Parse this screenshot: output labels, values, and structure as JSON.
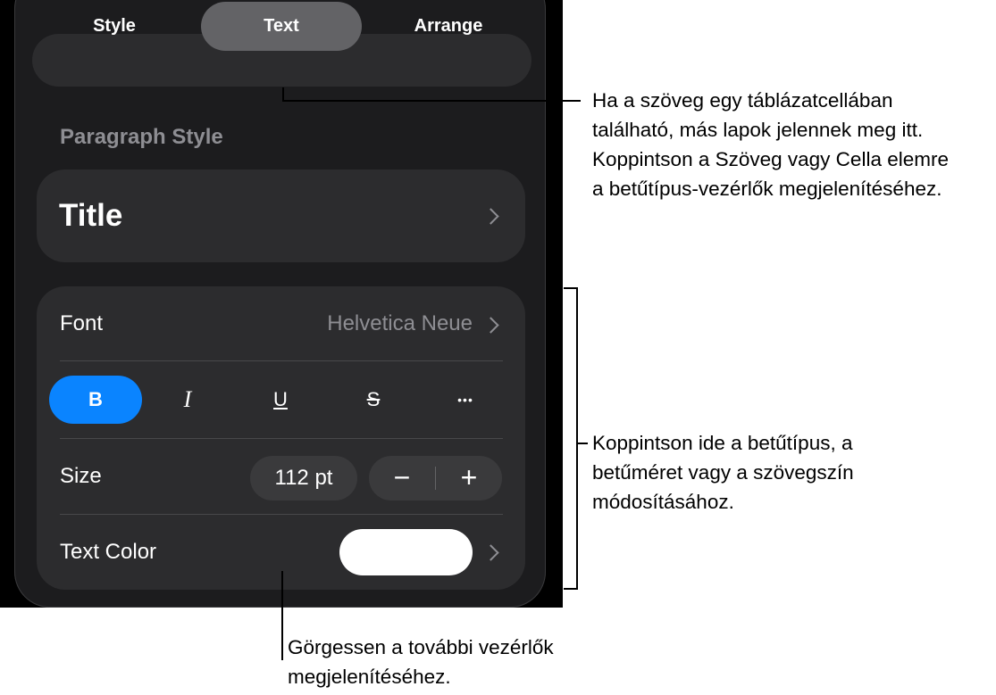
{
  "tabs": [
    {
      "label": "Style",
      "active": false
    },
    {
      "label": "Text",
      "active": true
    },
    {
      "label": "Arrange",
      "active": false
    }
  ],
  "paragraph_style": {
    "section_label": "Paragraph Style",
    "value": "Title"
  },
  "font_row": {
    "label": "Font",
    "value": "Helvetica Neue"
  },
  "format_buttons": [
    {
      "name": "bold",
      "symbol": "B",
      "active": true
    },
    {
      "name": "italic",
      "symbol": "I",
      "active": false
    },
    {
      "name": "underline",
      "symbol": "U",
      "active": false
    },
    {
      "name": "strikethrough",
      "symbol": "S",
      "active": false
    },
    {
      "name": "more",
      "symbol": "•••",
      "active": false
    }
  ],
  "size_row": {
    "label": "Size",
    "value": "112 pt",
    "decrement": "−",
    "increment": "+"
  },
  "text_color_row": {
    "label": "Text Color",
    "swatch_color": "#ffffff"
  },
  "colors": {
    "accent": "#0a84ff",
    "panel": "#1c1c1e",
    "card": "#2c2c2e"
  },
  "callouts": {
    "tabs_note": [
      "Ha a szöveg egy táblázatcellában",
      "található, más lapok jelennek meg itt.",
      "Koppintson a Szöveg vagy Cella elemre",
      "a betűtípus-vezérlők megjelenítéséhez."
    ],
    "font_note": [
      "Koppintson ide a betűtípus, a",
      "betűméret vagy a szövegszín",
      "módosításához."
    ],
    "scroll_note": [
      "Görgessen a további vezérlők",
      "megjelenítéséhez."
    ]
  }
}
